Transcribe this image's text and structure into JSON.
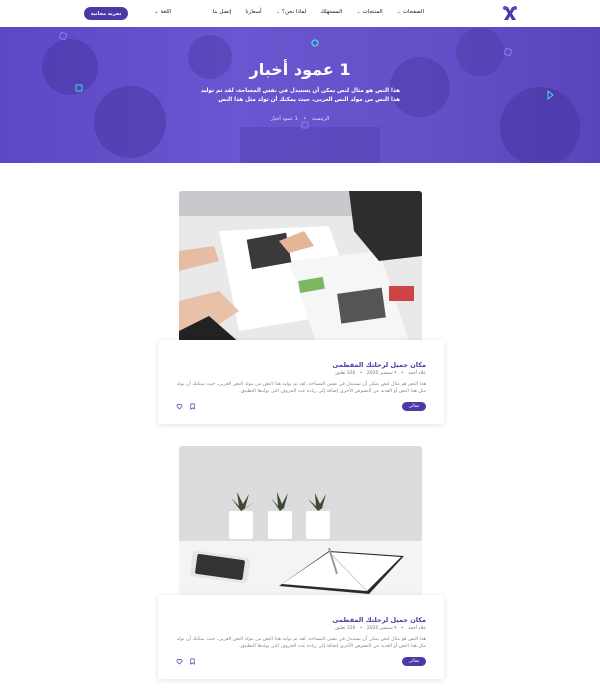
{
  "nav": {
    "menu": [
      {
        "label": "الصفحات",
        "has_dropdown": true
      },
      {
        "label": "المنتجات",
        "has_dropdown": true
      },
      {
        "label": "المستهلك",
        "has_dropdown": false
      },
      {
        "label": "لماذا نحن؟",
        "has_dropdown": true
      },
      {
        "label": "أسعارنا",
        "has_dropdown": false
      },
      {
        "label": "إتصل بنا",
        "has_dropdown": false
      }
    ],
    "language": "اللغة",
    "trial_button": "تجربة مجانية",
    "brand_color": "#4a3aa8"
  },
  "hero": {
    "title": "1 عمود أخبار",
    "description": "هذا النص هو مثال لنص يمكن أن يستبدل في نفس المساحة، لقد تم توليد هذا النص من مولد النص العربى، حيث يمكنك أن تولد مثل هذا النص",
    "breadcrumb": {
      "home": "الرئيسية",
      "separator": "•",
      "current": "1 عمود أخبار"
    }
  },
  "posts": [
    {
      "image": "office-meeting-papers",
      "title": "مكان جميل لرحلتك المقطمى",
      "author": "علاء أحمد",
      "date": "٩ سبتمبر 2020",
      "comments": "326 تعليق",
      "excerpt": "هذا النص هو مثال لنص يمكن أن يستبدل في نفس المساحة، لقد تم توليد هذا النص من مولد النص العربى، حيث يمكنك أن تولد مثل هذا النص أو العديد من النصوص الأخرى إضافة إلى زيادة عدد الحروف التى يولدها التطبيق.",
      "more_label": "مقالي"
    },
    {
      "image": "desk-plants-notebook",
      "title": "مكان جميل لرحلتك المقطمى",
      "author": "علاء أحمد",
      "date": "٩ سبتمبر 2020",
      "comments": "326 تعليق",
      "excerpt": "هذا النص هو مثال لنص يمكن أن يستبدل في نفس المساحة، لقد تم توليد هذا النص من مولد النص العربى، حيث يمكنك أن تولد مثل هذا النص أو العديد من النصوص الأخرى إضافة إلى زيادة عدد الحروف التى يولدها التطبيق.",
      "more_label": "مقالي"
    }
  ]
}
